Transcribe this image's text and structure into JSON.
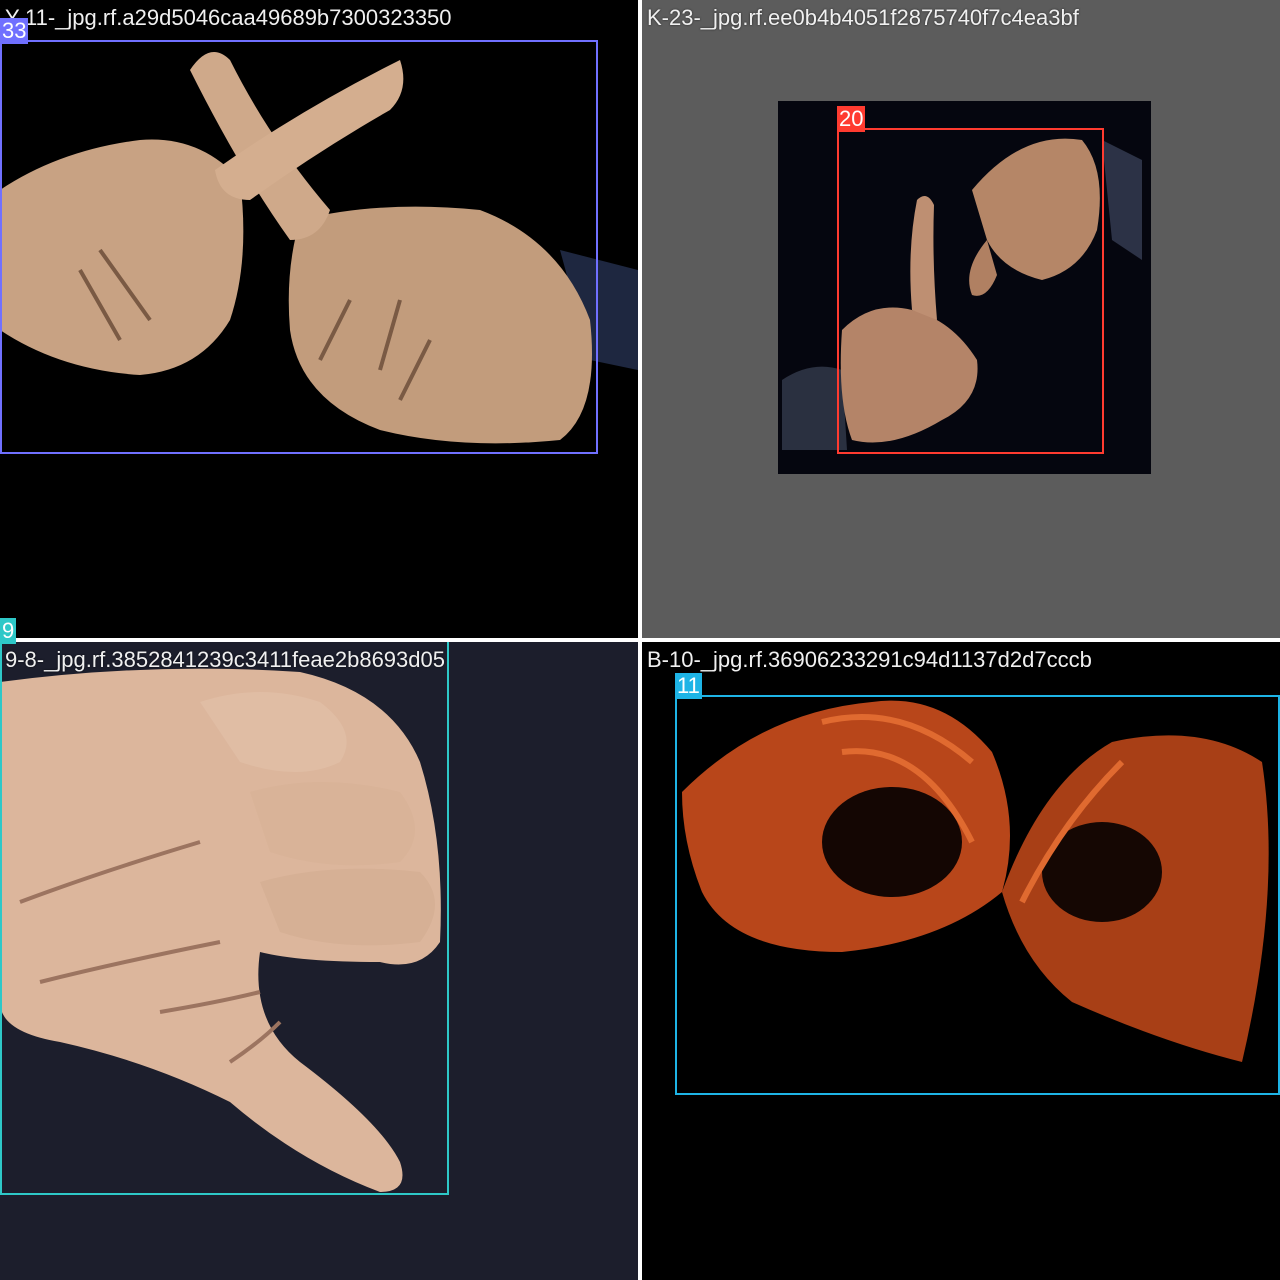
{
  "tiles": [
    {
      "filename": "Y-11-_jpg.rf.a29d5046caa49689b7300323350",
      "class_label": "33",
      "box_color": "#7070ff",
      "background": "#000000"
    },
    {
      "filename": "K-23-_jpg.rf.ee0b4b4051f2875740f7c4ea3bf",
      "class_label": "20",
      "box_color": "#ff3b30",
      "background": "#5c5c5c"
    },
    {
      "filename": "9-8-_jpg.rf.3852841239c3411feae2b8693d05",
      "class_label": "9",
      "box_color": "#2ec8c8",
      "background": "#1c1e2c"
    },
    {
      "filename": "B-10-_jpg.rf.36906233291c94d1137d2d7cccb",
      "class_label": "11",
      "box_color": "#1eb4e6",
      "background": "#000000"
    }
  ],
  "icons": {
    "hands": "hand-sign-photo"
  }
}
